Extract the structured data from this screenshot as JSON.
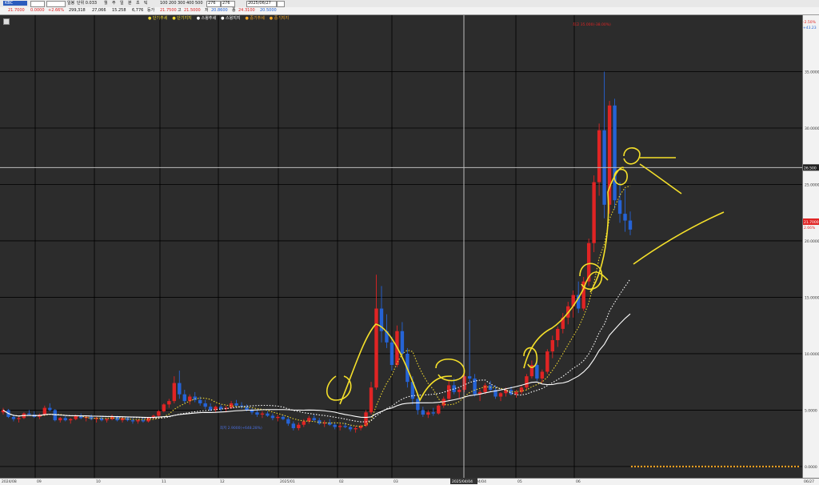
{
  "toolbar": {
    "symbol": "KBC",
    "period_label": "일봉",
    "ma_label": "단위 0.033",
    "options": [
      "월",
      "주",
      "일",
      "분",
      "초",
      "틱"
    ],
    "counts": [
      "100",
      "200",
      "300",
      "400",
      "500"
    ],
    "count_field": "276",
    "count_field2": "276",
    "date": "2025/06/27",
    "row2_price": "21.7000",
    "row2_diff": "0.0000",
    "row2_rate": "+2.66%",
    "row2_vol": "299,318",
    "row2_vol2": "27,066",
    "row2_amt": "15.258",
    "row2_prev": "6,776",
    "row2_prev_label": "등가",
    "row2_open": "21.7500",
    "row2_high": "21.5000",
    "row2_high_label": "고",
    "row2_low": "20.8600",
    "row2_low_label": "저",
    "row2_close": "24.3100",
    "row2_close_label": "종",
    "row2_last": "20.5000"
  },
  "legend": [
    {
      "label": "단기추세",
      "color": "#f0d830"
    },
    {
      "label": "단기지지",
      "color": "#f0d830"
    },
    {
      "label": "스윙추세",
      "color": "#ffffff"
    },
    {
      "label": "스윙지지",
      "color": "#ffffff"
    },
    {
      "label": "중기추세",
      "color": "#f5a623"
    },
    {
      "label": "중기지지",
      "color": "#f5a623"
    }
  ],
  "price_markers": {
    "high": "최고 35.000(-38.00%)",
    "low": "최저 2.9000(+648.28%)",
    "current": "21.7000",
    "current_pct": "2.66%",
    "crosshair": "26.500",
    "top_right1": "-2.50%",
    "top_right2": "+43.23"
  },
  "chart_data": {
    "type": "candlestick",
    "y_ticks": [
      "35.0000",
      "30.0000",
      "25.0000",
      "20.0000",
      "15.0000",
      "10.0000",
      "5.0000",
      "0.0000"
    ],
    "x_ticks": [
      "2024/08",
      "09",
      "10",
      "11",
      "12",
      "2025/01",
      "02",
      "03",
      "2025/04/04",
      "05",
      "06",
      "06/27"
    ],
    "ylim": [
      -1,
      40
    ],
    "crosshair_date": "2025/04/04",
    "crosshair_price": 26.5,
    "candles": [
      [
        4.8,
        5.2,
        4.6,
        5.0
      ],
      [
        5.0,
        5.1,
        4.3,
        4.4
      ],
      [
        4.4,
        4.6,
        4.0,
        4.2
      ],
      [
        4.2,
        4.5,
        3.9,
        4.3
      ],
      [
        4.3,
        4.8,
        4.2,
        4.7
      ],
      [
        4.7,
        5.0,
        4.5,
        4.6
      ],
      [
        4.6,
        4.9,
        4.3,
        4.4
      ],
      [
        4.4,
        4.7,
        4.2,
        4.6
      ],
      [
        4.6,
        5.4,
        4.5,
        5.2
      ],
      [
        5.2,
        5.6,
        4.9,
        5.0
      ],
      [
        5.0,
        5.1,
        4.0,
        4.1
      ],
      [
        4.1,
        4.4,
        3.9,
        4.3
      ],
      [
        4.3,
        4.5,
        4.0,
        4.1
      ],
      [
        4.1,
        4.3,
        3.8,
        4.2
      ],
      [
        4.2,
        4.6,
        4.1,
        4.5
      ],
      [
        4.5,
        4.7,
        4.2,
        4.3
      ],
      [
        4.3,
        4.5,
        4.0,
        4.4
      ],
      [
        4.4,
        4.6,
        4.1,
        4.2
      ],
      [
        4.2,
        4.4,
        3.9,
        4.3
      ],
      [
        4.3,
        4.5,
        4.0,
        4.1
      ],
      [
        4.1,
        4.3,
        3.9,
        4.2
      ],
      [
        4.2,
        4.6,
        4.1,
        4.4
      ],
      [
        4.4,
        4.5,
        4.0,
        4.1
      ],
      [
        4.1,
        4.4,
        3.9,
        4.3
      ],
      [
        4.3,
        4.4,
        4.0,
        4.1
      ],
      [
        4.1,
        4.3,
        3.8,
        4.0
      ],
      [
        4.0,
        4.2,
        3.8,
        4.1
      ],
      [
        4.1,
        4.3,
        3.9,
        4.0
      ],
      [
        4.0,
        4.4,
        3.9,
        4.3
      ],
      [
        4.3,
        4.6,
        4.2,
        4.5
      ],
      [
        4.5,
        5.0,
        4.4,
        4.9
      ],
      [
        4.9,
        5.6,
        4.8,
        5.5
      ],
      [
        5.5,
        6.0,
        5.2,
        5.8
      ],
      [
        5.8,
        8.0,
        5.6,
        7.4
      ],
      [
        7.4,
        8.5,
        6.0,
        6.4
      ],
      [
        6.4,
        6.8,
        5.6,
        5.8
      ],
      [
        5.8,
        6.4,
        5.5,
        6.2
      ],
      [
        6.2,
        6.6,
        5.7,
        5.9
      ],
      [
        5.9,
        6.2,
        5.4,
        5.6
      ],
      [
        5.6,
        5.9,
        5.1,
        5.3
      ],
      [
        5.3,
        5.6,
        4.9,
        5.0
      ],
      [
        5.0,
        5.4,
        4.8,
        5.3
      ],
      [
        5.3,
        5.5,
        4.9,
        5.1
      ],
      [
        5.1,
        5.4,
        4.8,
        5.2
      ],
      [
        5.2,
        5.8,
        5.1,
        5.6
      ],
      [
        5.6,
        5.9,
        5.2,
        5.4
      ],
      [
        5.4,
        5.7,
        5.1,
        5.3
      ],
      [
        5.3,
        5.5,
        4.9,
        5.0
      ],
      [
        5.0,
        5.2,
        4.6,
        4.8
      ],
      [
        4.8,
        5.0,
        4.4,
        4.6
      ],
      [
        4.6,
        4.9,
        4.3,
        4.7
      ],
      [
        4.7,
        4.9,
        4.4,
        4.5
      ],
      [
        4.5,
        4.7,
        4.1,
        4.3
      ],
      [
        4.3,
        4.6,
        4.0,
        4.4
      ],
      [
        4.4,
        4.6,
        4.1,
        4.2
      ],
      [
        4.2,
        4.4,
        3.6,
        3.8
      ],
      [
        3.8,
        4.0,
        3.2,
        3.4
      ],
      [
        3.4,
        3.9,
        3.2,
        3.7
      ],
      [
        3.7,
        4.2,
        3.5,
        4.0
      ],
      [
        4.0,
        4.5,
        3.8,
        4.3
      ],
      [
        4.3,
        4.6,
        4.0,
        4.1
      ],
      [
        4.1,
        4.3,
        3.7,
        3.8
      ],
      [
        3.8,
        4.1,
        3.5,
        3.9
      ],
      [
        3.9,
        4.2,
        3.6,
        3.7
      ],
      [
        3.7,
        3.9,
        3.3,
        3.5
      ],
      [
        3.5,
        3.8,
        3.2,
        3.6
      ],
      [
        3.6,
        3.9,
        3.4,
        3.5
      ],
      [
        3.5,
        3.7,
        3.1,
        3.3
      ],
      [
        3.3,
        3.6,
        3.0,
        3.4
      ],
      [
        3.4,
        3.7,
        3.2,
        3.6
      ],
      [
        3.6,
        5.0,
        3.5,
        4.8
      ],
      [
        4.8,
        7.5,
        4.6,
        7.0
      ],
      [
        7.0,
        17.0,
        6.8,
        14.0
      ],
      [
        14.0,
        16.0,
        11.0,
        12.0
      ],
      [
        12.0,
        13.5,
        10.5,
        11.0
      ],
      [
        11.0,
        11.5,
        8.5,
        9.0
      ],
      [
        9.0,
        12.5,
        8.8,
        12.0
      ],
      [
        12.0,
        12.8,
        9.5,
        10.0
      ],
      [
        10.0,
        10.5,
        7.0,
        7.5
      ],
      [
        7.5,
        8.0,
        5.5,
        6.0
      ],
      [
        6.0,
        6.4,
        4.6,
        5.0
      ],
      [
        5.0,
        5.3,
        4.4,
        4.6
      ],
      [
        4.6,
        5.0,
        4.3,
        4.8
      ],
      [
        4.8,
        5.2,
        4.5,
        4.7
      ],
      [
        4.7,
        5.5,
        4.6,
        5.4
      ],
      [
        5.4,
        6.2,
        5.2,
        6.0
      ],
      [
        6.0,
        7.6,
        5.8,
        7.2
      ],
      [
        7.2,
        7.8,
        6.4,
        6.6
      ],
      [
        6.6,
        7.0,
        6.0,
        6.8
      ],
      [
        6.8,
        8.5,
        6.6,
        8.0
      ],
      [
        8.0,
        13.0,
        7.5,
        7.8
      ],
      [
        7.8,
        8.2,
        6.2,
        6.4
      ],
      [
        6.4,
        6.8,
        5.8,
        6.6
      ],
      [
        6.6,
        7.4,
        6.4,
        7.2
      ],
      [
        7.2,
        7.6,
        6.6,
        6.8
      ],
      [
        6.8,
        7.2,
        6.0,
        6.2
      ],
      [
        6.2,
        6.6,
        5.8,
        6.5
      ],
      [
        6.5,
        7.0,
        6.2,
        6.8
      ],
      [
        6.8,
        7.1,
        6.3,
        6.4
      ],
      [
        6.4,
        6.8,
        6.1,
        6.6
      ],
      [
        6.6,
        7.2,
        6.4,
        7.0
      ],
      [
        7.0,
        8.2,
        6.8,
        8.0
      ],
      [
        8.0,
        9.4,
        7.8,
        9.0
      ],
      [
        9.0,
        9.6,
        7.6,
        7.8
      ],
      [
        7.8,
        8.6,
        7.4,
        8.4
      ],
      [
        8.4,
        10.4,
        8.2,
        10.2
      ],
      [
        10.2,
        11.6,
        9.6,
        11.2
      ],
      [
        11.2,
        12.4,
        10.6,
        12.2
      ],
      [
        12.2,
        13.6,
        11.8,
        13.2
      ],
      [
        13.2,
        14.6,
        12.6,
        14.2
      ],
      [
        14.2,
        15.6,
        13.2,
        15.2
      ],
      [
        15.2,
        16.4,
        13.6,
        14.0
      ],
      [
        14.0,
        16.8,
        13.8,
        16.4
      ],
      [
        16.4,
        20.2,
        16.0,
        19.8
      ],
      [
        19.8,
        25.8,
        19.0,
        25.2
      ],
      [
        25.2,
        30.4,
        24.0,
        29.8
      ],
      [
        29.8,
        35.0,
        22.0,
        23.2
      ],
      [
        23.2,
        32.4,
        22.4,
        32.0
      ],
      [
        32.0,
        32.6,
        22.8,
        23.6
      ],
      [
        23.6,
        25.2,
        21.6,
        22.4
      ],
      [
        22.4,
        24.6,
        20.8,
        21.8
      ],
      [
        21.8,
        22.6,
        20.5,
        21.0
      ]
    ]
  }
}
